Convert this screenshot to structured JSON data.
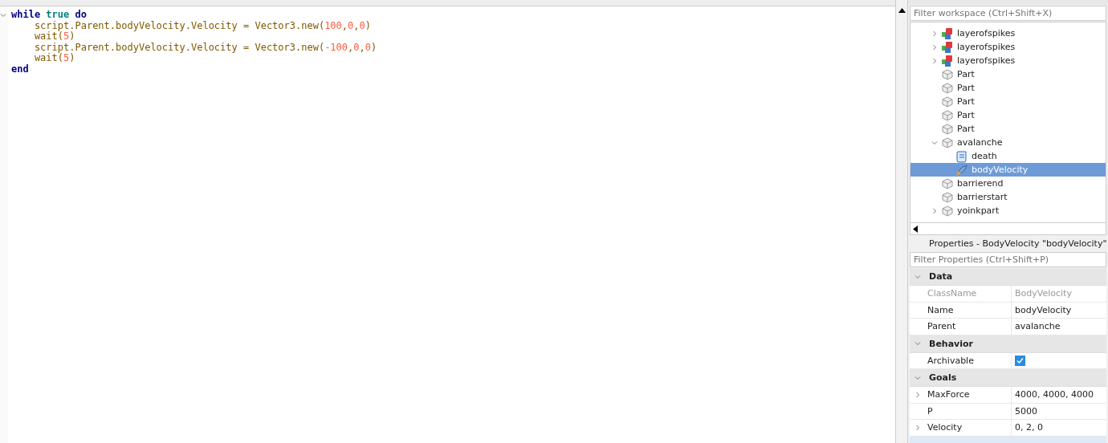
{
  "editor": {
    "lines": [
      [
        {
          "kind": "keyword",
          "text": "while"
        },
        {
          "kind": "literal",
          "text": " true"
        },
        {
          "kind": "keyword",
          "text": " do"
        }
      ],
      [
        {
          "kind": "plain",
          "text": "    script.Parent.bodyVelocity.Velocity = Vector3.new("
        },
        {
          "kind": "number",
          "text": "100"
        },
        {
          "kind": "plain",
          "text": ","
        },
        {
          "kind": "number",
          "text": "0"
        },
        {
          "kind": "plain",
          "text": ","
        },
        {
          "kind": "number",
          "text": "0"
        },
        {
          "kind": "plain",
          "text": ")"
        }
      ],
      [
        {
          "kind": "plain",
          "text": "    wait("
        },
        {
          "kind": "number",
          "text": "5"
        },
        {
          "kind": "plain",
          "text": ")"
        }
      ],
      [
        {
          "kind": "plain",
          "text": "    script.Parent.bodyVelocity.Velocity = Vector3.new("
        },
        {
          "kind": "number",
          "text": "-100"
        },
        {
          "kind": "plain",
          "text": ","
        },
        {
          "kind": "number",
          "text": "0"
        },
        {
          "kind": "plain",
          "text": ","
        },
        {
          "kind": "number",
          "text": "0"
        },
        {
          "kind": "plain",
          "text": ")"
        }
      ],
      [
        {
          "kind": "plain",
          "text": "    wait("
        },
        {
          "kind": "number",
          "text": "5"
        },
        {
          "kind": "plain",
          "text": ")"
        }
      ],
      [
        {
          "kind": "keyword",
          "text": "end"
        }
      ]
    ]
  },
  "explorer": {
    "filter": {
      "placeholder": "Filter workspace (Ctrl+Shift+X)"
    },
    "items": [
      {
        "name": "layerofspikes",
        "kind": "model",
        "expanded": false,
        "selected": false
      },
      {
        "name": "layerofspikes",
        "kind": "model",
        "expanded": false,
        "selected": false
      },
      {
        "name": "layerofspikes",
        "kind": "model",
        "expanded": false,
        "selected": false
      },
      {
        "name": "Part",
        "kind": "part",
        "selected": false
      },
      {
        "name": "Part",
        "kind": "part",
        "selected": false
      },
      {
        "name": "Part",
        "kind": "part",
        "selected": false
      },
      {
        "name": "Part",
        "kind": "part",
        "selected": false
      },
      {
        "name": "Part",
        "kind": "part",
        "selected": false
      },
      {
        "name": "avalanche",
        "kind": "part",
        "expanded": true,
        "selected": false,
        "children": [
          {
            "name": "death",
            "kind": "script",
            "selected": false
          },
          {
            "name": "bodyVelocity",
            "kind": "velocity",
            "selected": true
          }
        ]
      },
      {
        "name": "barrierend",
        "kind": "part",
        "selected": false
      },
      {
        "name": "barrierstart",
        "kind": "part",
        "selected": false
      },
      {
        "name": "yoinkpart",
        "kind": "part",
        "expanded": false,
        "selected": false
      }
    ]
  },
  "properties": {
    "title": "Properties - BodyVelocity \"bodyVelocity\"",
    "filter": {
      "placeholder": "Filter Properties (Ctrl+Shift+P)"
    },
    "sections": [
      {
        "name": "Data",
        "expanded": true,
        "rows": [
          {
            "kind": "text",
            "name": "ClassName",
            "value": "BodyVelocity",
            "disabled": true
          },
          {
            "kind": "text",
            "name": "Name",
            "value": "bodyVelocity",
            "disabled": false
          },
          {
            "kind": "text",
            "name": "Parent",
            "value": "avalanche",
            "disabled": false
          }
        ]
      },
      {
        "name": "Behavior",
        "expanded": true,
        "rows": [
          {
            "kind": "checkbox",
            "name": "Archivable",
            "checked": true
          }
        ]
      },
      {
        "name": "Goals",
        "expanded": true,
        "rows": [
          {
            "kind": "text",
            "name": "MaxForce",
            "value": "4000, 4000, 4000",
            "disabled": false,
            "expanded": false
          },
          {
            "kind": "text",
            "name": "P",
            "value": "5000",
            "disabled": false
          },
          {
            "kind": "text",
            "name": "Velocity",
            "value": "0, 2, 0",
            "disabled": false,
            "expanded": false
          }
        ]
      }
    ]
  }
}
